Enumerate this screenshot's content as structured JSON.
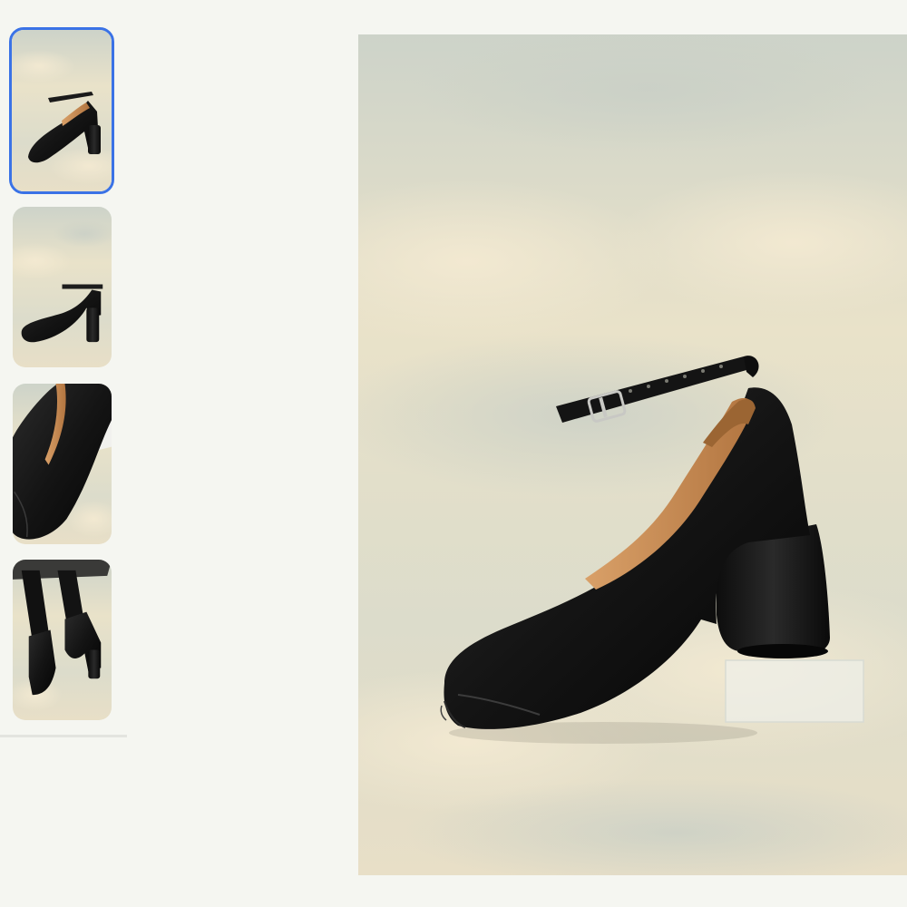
{
  "gallery": {
    "selected_index": 0,
    "thumbnails": [
      {
        "icon": "shoe-side-view-image",
        "selected": true
      },
      {
        "icon": "shoe-profile-image",
        "selected": false
      },
      {
        "icon": "shoe-toe-closeup-image",
        "selected": false
      },
      {
        "icon": "shoe-worn-on-foot-image",
        "selected": false
      }
    ],
    "main_image": {
      "icon": "shoe-main-product-image"
    }
  },
  "colors": {
    "selected_border": "#3a72e6",
    "page_background": "#f5f6f1",
    "sky": "#e7e3d0",
    "leather": "#161616",
    "lining": "#c98c4e"
  }
}
